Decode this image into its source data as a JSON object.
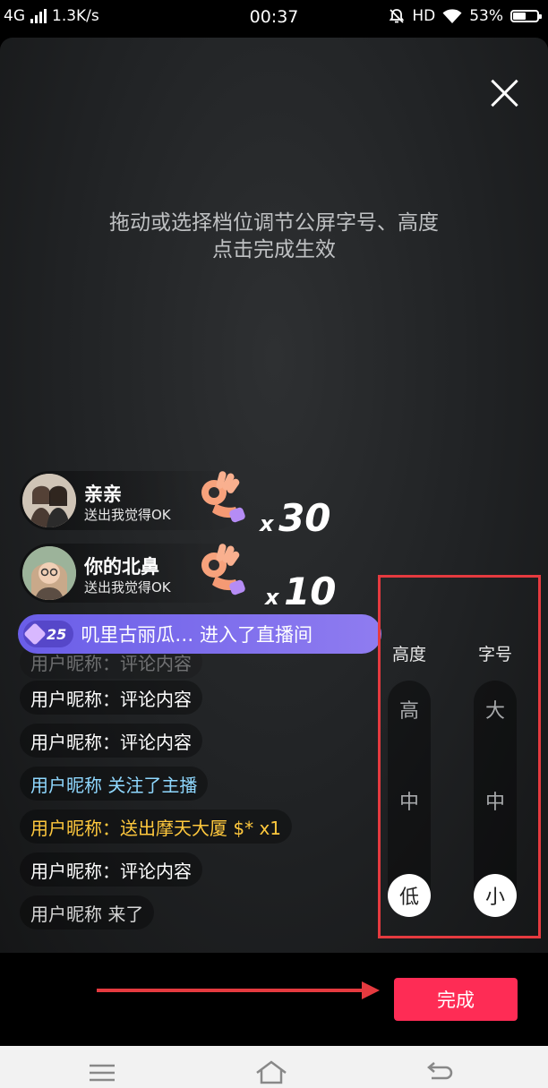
{
  "status_bar": {
    "network": "4G",
    "speed": "1.3K/s",
    "time": "00:37",
    "hd": "HD",
    "battery": "53%"
  },
  "overlay": {
    "hint_line1": "拖动或选择档位调节公屏字号、高度",
    "hint_line2": "点击完成生效"
  },
  "gifts": [
    {
      "name": "亲亲",
      "desc": "送出我觉得OK",
      "x": "x",
      "count": "30"
    },
    {
      "name": "你的北鼻",
      "desc": "送出我觉得OK",
      "x": "x",
      "count": "10"
    }
  ],
  "enter_notice": {
    "level": "25",
    "text": "叽里古丽瓜… 进入了直播间"
  },
  "comments": [
    {
      "text": "用户昵称：评论内容",
      "color": "#ffffff"
    },
    {
      "text": "用户昵称：评论内容",
      "color": "#ffffff"
    },
    {
      "text": "用户昵称：评论内容",
      "color": "#ffffff"
    },
    {
      "text": "用户昵称 关注了主播",
      "color": "#8fd8ff"
    },
    {
      "text": "用户昵称：送出摩天大厦 $* x1",
      "color": "#ffc83d"
    },
    {
      "text": "用户昵称：评论内容",
      "color": "#ffffff"
    },
    {
      "text": "用户昵称 来了",
      "color": "#d6d6d6"
    }
  ],
  "panel": {
    "height": {
      "title": "高度",
      "options": [
        "高",
        "中",
        "低"
      ],
      "selected": "低"
    },
    "font": {
      "title": "字号",
      "options": [
        "大",
        "中",
        "小"
      ],
      "selected": "小"
    }
  },
  "done_label": "完成",
  "colors": {
    "accent": "#fe2c55",
    "annotation": "#e53a3f",
    "level_badge": "#6a5ee8"
  }
}
